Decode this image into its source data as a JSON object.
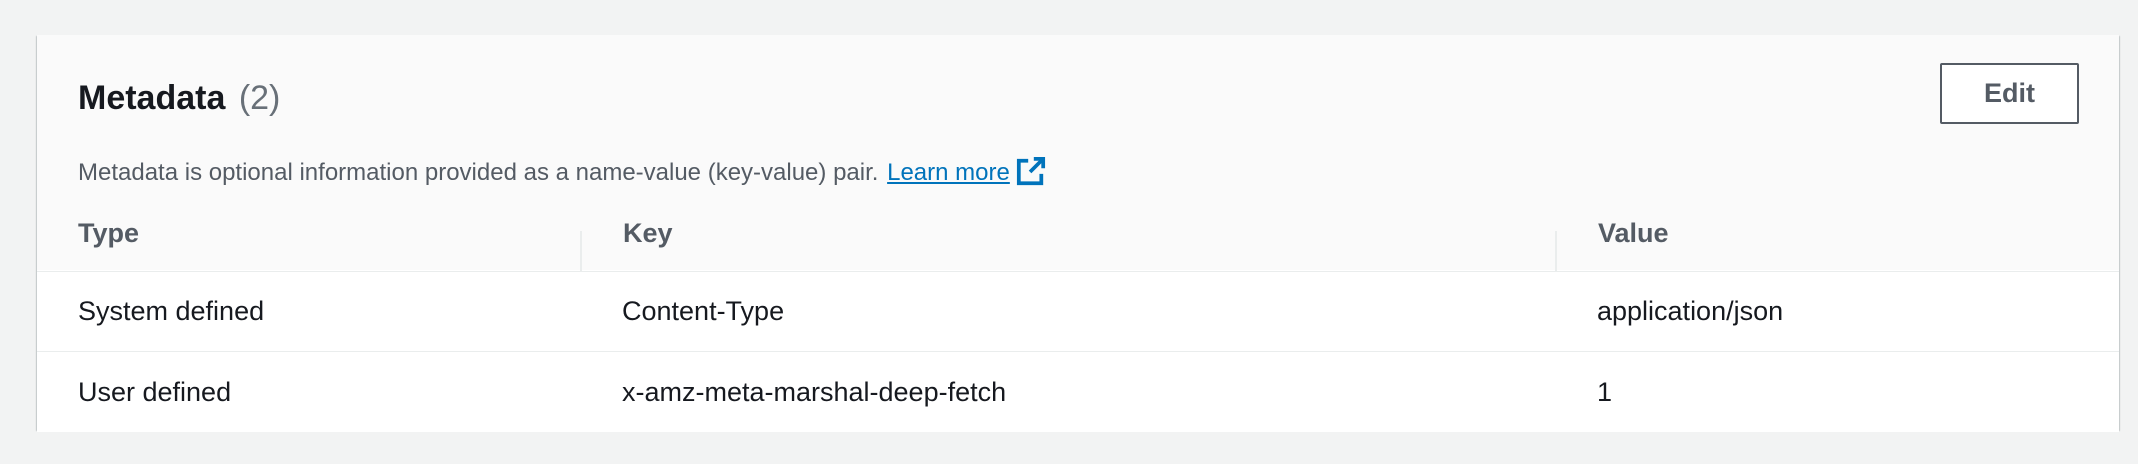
{
  "metadata": {
    "title": "Metadata",
    "count": "(2)",
    "description": "Metadata is optional information provided as a name-value (key-value) pair.",
    "learn_more": "Learn more",
    "edit_label": "Edit",
    "columns": [
      "Type",
      "Key",
      "Value"
    ],
    "rows": [
      {
        "type": "System defined",
        "key": "Content-Type",
        "value": "application/json"
      },
      {
        "type": "User defined",
        "key": "x-amz-meta-marshal-deep-fetch",
        "value": "1"
      }
    ],
    "icons": {
      "learn_more": "external-link-icon"
    },
    "colors": {
      "link": "#0073bb",
      "text": "#16191f",
      "muted": "#545b64"
    }
  }
}
